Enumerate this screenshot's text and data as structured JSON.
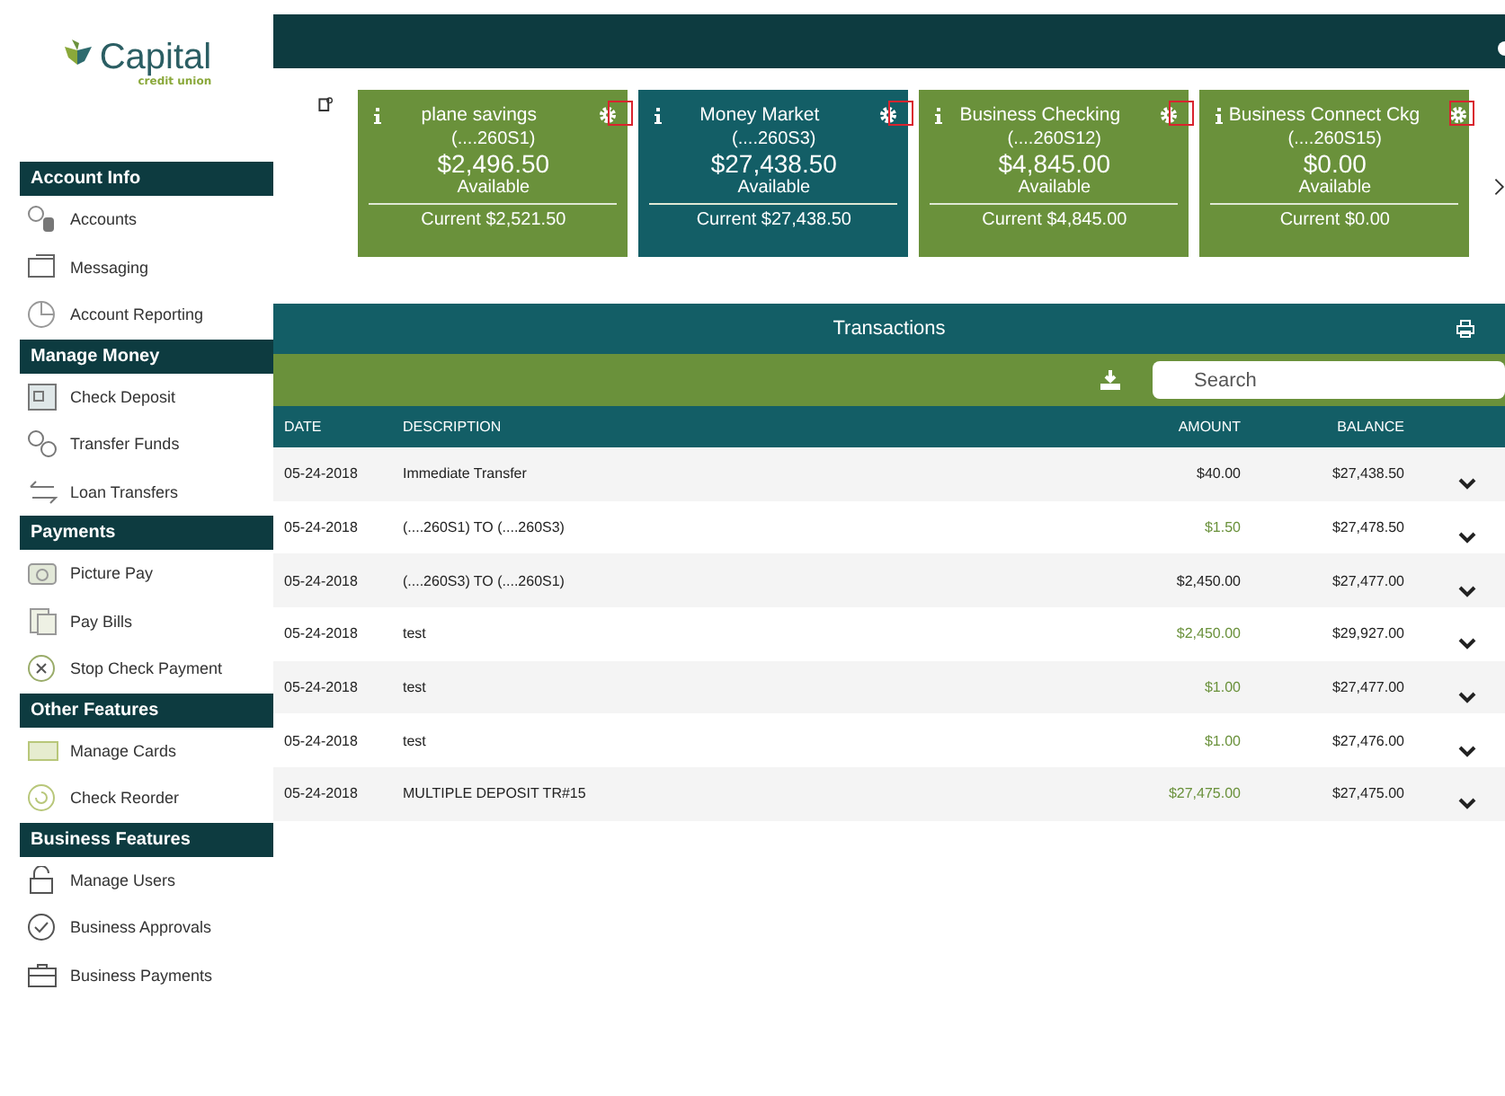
{
  "logo": {
    "name": "Capital",
    "tagline": "credit union"
  },
  "sidebar": {
    "sections": [
      {
        "title": "Account Info",
        "items": [
          {
            "label": "Accounts"
          },
          {
            "label": "Messaging"
          },
          {
            "label": "Account Reporting"
          }
        ]
      },
      {
        "title": "Manage Money",
        "items": [
          {
            "label": "Check Deposit"
          },
          {
            "label": "Transfer Funds"
          },
          {
            "label": "Loan Transfers"
          }
        ]
      },
      {
        "title": "Payments",
        "items": [
          {
            "label": "Picture Pay"
          },
          {
            "label": "Pay Bills"
          },
          {
            "label": "Stop Check Payment"
          }
        ]
      },
      {
        "title": "Other Features",
        "items": [
          {
            "label": "Manage Cards"
          },
          {
            "label": "Check Reorder"
          }
        ]
      },
      {
        "title": "Business Features",
        "items": [
          {
            "label": "Manage Users"
          },
          {
            "label": "Business Approvals"
          },
          {
            "label": "Business Payments"
          }
        ]
      }
    ]
  },
  "accounts": [
    {
      "name": "plane savings",
      "number": "(....260S1)",
      "available": "$2,496.50",
      "available_label": "Available",
      "current": "Current $2,521.50",
      "selected": false,
      "highlighted": true
    },
    {
      "name": "Money Market",
      "number": "(....260S3)",
      "available": "$27,438.50",
      "available_label": "Available",
      "current": "Current $27,438.50",
      "selected": true,
      "highlighted": true
    },
    {
      "name": "Business Checking",
      "number": "(....260S12)",
      "available": "$4,845.00",
      "available_label": "Available",
      "current": "Current $4,845.00",
      "selected": false,
      "highlighted": true
    },
    {
      "name": "Business Connect Ckg",
      "number": "(....260S15)",
      "available": "$0.00",
      "available_label": "Available",
      "current": "Current $0.00",
      "selected": false,
      "highlighted": true
    }
  ],
  "transactions": {
    "title": "Transactions",
    "search": {
      "placeholder": "Search"
    },
    "columns": [
      "DATE",
      "DESCRIPTION",
      "AMOUNT",
      "BALANCE"
    ],
    "rows": [
      {
        "date": "05-24-2018",
        "description": "Immediate Transfer",
        "amount": "$40.00",
        "balance": "$27,438.50",
        "kind": "debit"
      },
      {
        "date": "05-24-2018",
        "description": "(....260S1) TO (....260S3)",
        "amount": "$1.50",
        "balance": "$27,478.50",
        "kind": "credit"
      },
      {
        "date": "05-24-2018",
        "description": "(....260S3) TO (....260S1)",
        "amount": "$2,450.00",
        "balance": "$27,477.00",
        "kind": "debit"
      },
      {
        "date": "05-24-2018",
        "description": "test",
        "amount": "$2,450.00",
        "balance": "$29,927.00",
        "kind": "credit"
      },
      {
        "date": "05-24-2018",
        "description": "test",
        "amount": "$1.00",
        "balance": "$27,477.00",
        "kind": "credit"
      },
      {
        "date": "05-24-2018",
        "description": "test",
        "amount": "$1.00",
        "balance": "$27,476.00",
        "kind": "credit"
      },
      {
        "date": "05-24-2018",
        "description": "MULTIPLE DEPOSIT TR#15",
        "amount": "$27,475.00",
        "balance": "$27,475.00",
        "kind": "credit"
      }
    ]
  }
}
